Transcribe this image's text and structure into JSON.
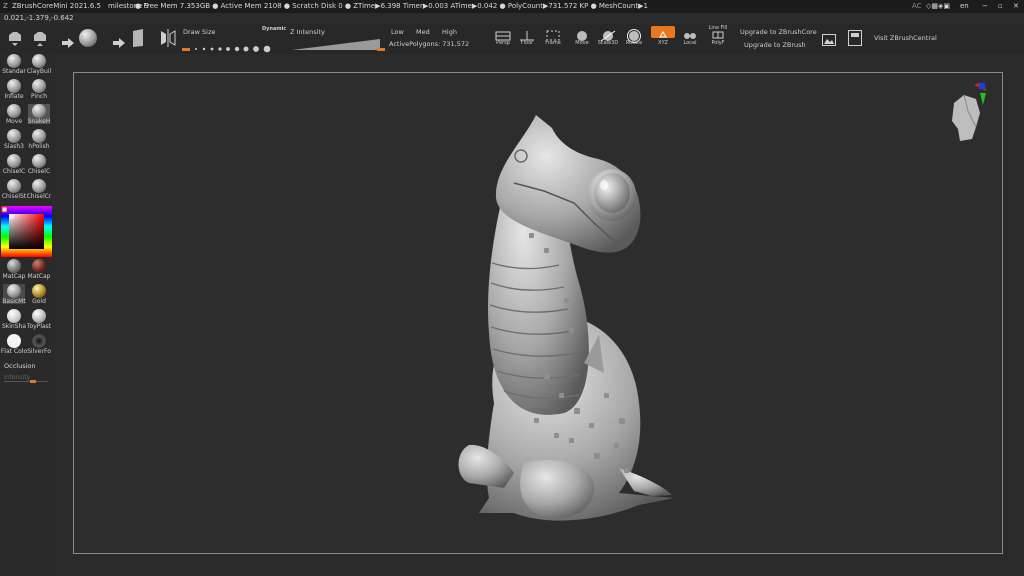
{
  "titlebar": {
    "app": "ZBrushCoreMini 2021.6.5",
    "milestone": "milestone 9",
    "stats": "● Free Mem 7.353GB ● Active Mem 2108 ● Scratch Disk 0 ● ZTime▶6.398 Timer▶0.003 ATime▶0.042 ● PolyCount▶731.572 KP ● MeshCount▶1",
    "ac": "AC",
    "lang": "en"
  },
  "coords": "0.021,-1.379,-0.642",
  "toolbar": {
    "draw_size": "Draw Size",
    "dynamic": "Dynamic",
    "z_intensity": "Z Intensity",
    "low": "Low",
    "med": "Med",
    "high": "High",
    "active_polygons": "ActivePolygons: 731,572",
    "persp": "Persp",
    "floor": "Floor",
    "frame": "Frame",
    "move": "Move",
    "scale3d": "Scale3D",
    "rotate": "Rotate",
    "xyz": "XYZ",
    "local": "Local",
    "line_fill": "Line Fill",
    "polyf": "PolyF",
    "upgrade_core": "Upgrade to ZBrushCore",
    "upgrade_zbrush": "Upgrade to ZBrush",
    "visit": "Visit ZBrushCentral"
  },
  "shelf": {
    "brushes": [
      {
        "label": "Standar"
      },
      {
        "label": "ClayBuil"
      },
      {
        "label": "Inflate"
      },
      {
        "label": "Pinch"
      },
      {
        "label": "Move"
      },
      {
        "label": "SnakeH"
      },
      {
        "label": "Slash3"
      },
      {
        "label": "hPolish"
      },
      {
        "label": "ChiselC"
      },
      {
        "label": "ChiselC"
      },
      {
        "label": "ChiselSt"
      },
      {
        "label": "ChiselCr"
      }
    ],
    "materials": [
      {
        "label": "MatCap"
      },
      {
        "label": "MatCap"
      },
      {
        "label": "BasicMt"
      },
      {
        "label": "Gold"
      },
      {
        "label": "SkinSha"
      },
      {
        "label": "ToyPlast"
      },
      {
        "label": "Flat Colo"
      },
      {
        "label": "SilverFo"
      }
    ],
    "occlusion": "Occlusion",
    "intensity": "Intensity"
  },
  "colors": {
    "accent_orange": "#e8781f",
    "axis_red": "#e01b1b",
    "axis_green": "#1fc01f",
    "axis_blue": "#1b3fe0"
  }
}
